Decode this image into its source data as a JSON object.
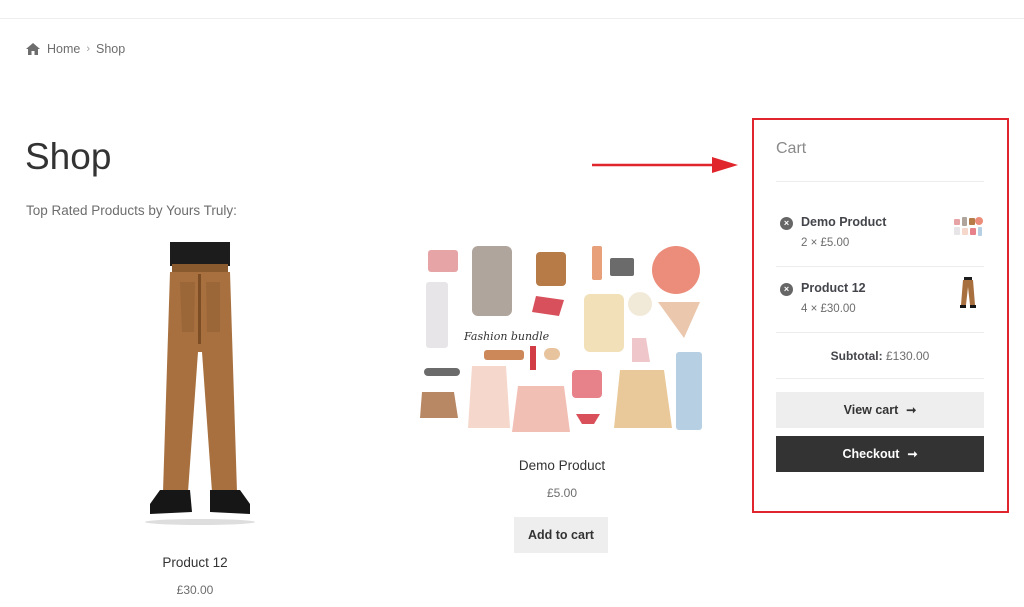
{
  "breadcrumb": {
    "home": "Home",
    "current": "Shop"
  },
  "page": {
    "title": "Shop",
    "section_heading": "Top Rated Products by Yours Truly:"
  },
  "products": [
    {
      "title": "Product 12",
      "price": "£30.00",
      "image": "brown-work-pants-image"
    },
    {
      "title": "Demo Product",
      "price": "£5.00",
      "image": "fashion-bundle-image",
      "image_caption": "Fashion bundle",
      "button": "Add to cart"
    }
  ],
  "cart": {
    "title": "Cart",
    "items": [
      {
        "name": "Demo Product",
        "qty": "2 × £5.00"
      },
      {
        "name": "Product 12",
        "qty": "4 × £30.00"
      }
    ],
    "subtotal_label": "Subtotal:",
    "subtotal_value": "£130.00",
    "view_cart": "View cart",
    "checkout": "Checkout",
    "arrow": "➞"
  },
  "colors": {
    "annotation": "#e0262c",
    "checkout_bg": "#333333",
    "button_bg": "#eeeeee"
  }
}
